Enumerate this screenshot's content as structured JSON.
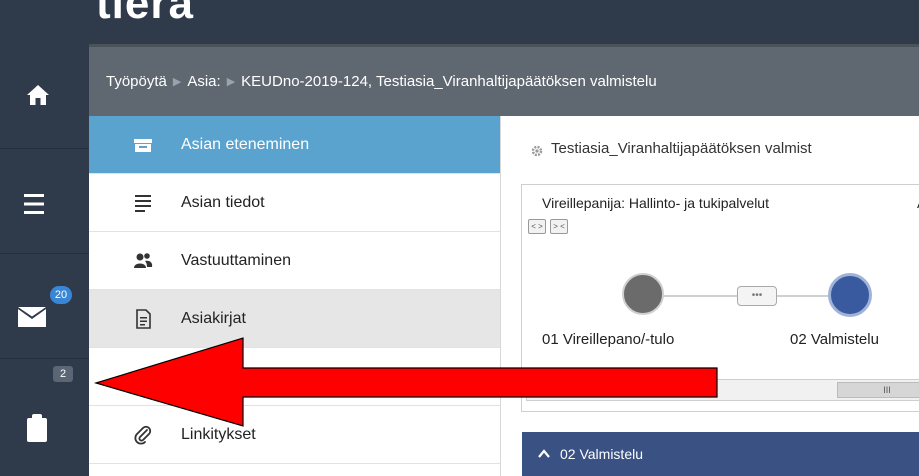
{
  "brand": {
    "logo": "tiera"
  },
  "breadcrumb": {
    "items": [
      "Työpöytä",
      "Asia:",
      "KEUDno-2019-124, Testiasia_Viranhaltijapäätöksen valmistelu"
    ]
  },
  "leftbar": {
    "mail_badge": "20",
    "tasks_badge": "2"
  },
  "menu": {
    "items": [
      {
        "label": "Asian eteneminen",
        "icon": "inbox-tray-icon",
        "active": true
      },
      {
        "label": "Asian tiedot",
        "icon": "list-lines-icon"
      },
      {
        "label": "Vastuuttaminen",
        "icon": "users-icon"
      },
      {
        "label": "Asiakirjat",
        "icon": "document-icon",
        "highlight": true
      },
      {
        "label": "",
        "icon": "circle-icon"
      },
      {
        "label": "Linkitykset",
        "icon": "paperclip-icon"
      }
    ]
  },
  "main": {
    "title": "Testiasia_Viranhaltijapäätöksen valmist",
    "process_label": "Vireillepanija: Hallinto- ja tukipalvelut",
    "process_label_extra": "A",
    "toggle_expand": "< >",
    "toggle_collapse": "> <",
    "steps": [
      {
        "label": "01 Vireillepano/-tulo",
        "color": "#6b6b6b"
      },
      {
        "label": "02 Valmistelu",
        "color": "#3a5aa0"
      }
    ],
    "connector": "•••",
    "scroll_grip": "III",
    "phase_header": "02 Valmistelu"
  },
  "colors": {
    "dark_nav": "#2f3a4b",
    "breadcrumb_bg": "#5f6871",
    "active_menu": "#5ba3cf",
    "highlight_menu": "#e6e6e6",
    "phase_bar": "#3a5183",
    "badge_blue": "#3a86d6",
    "arrow_red": "#ff0000"
  }
}
